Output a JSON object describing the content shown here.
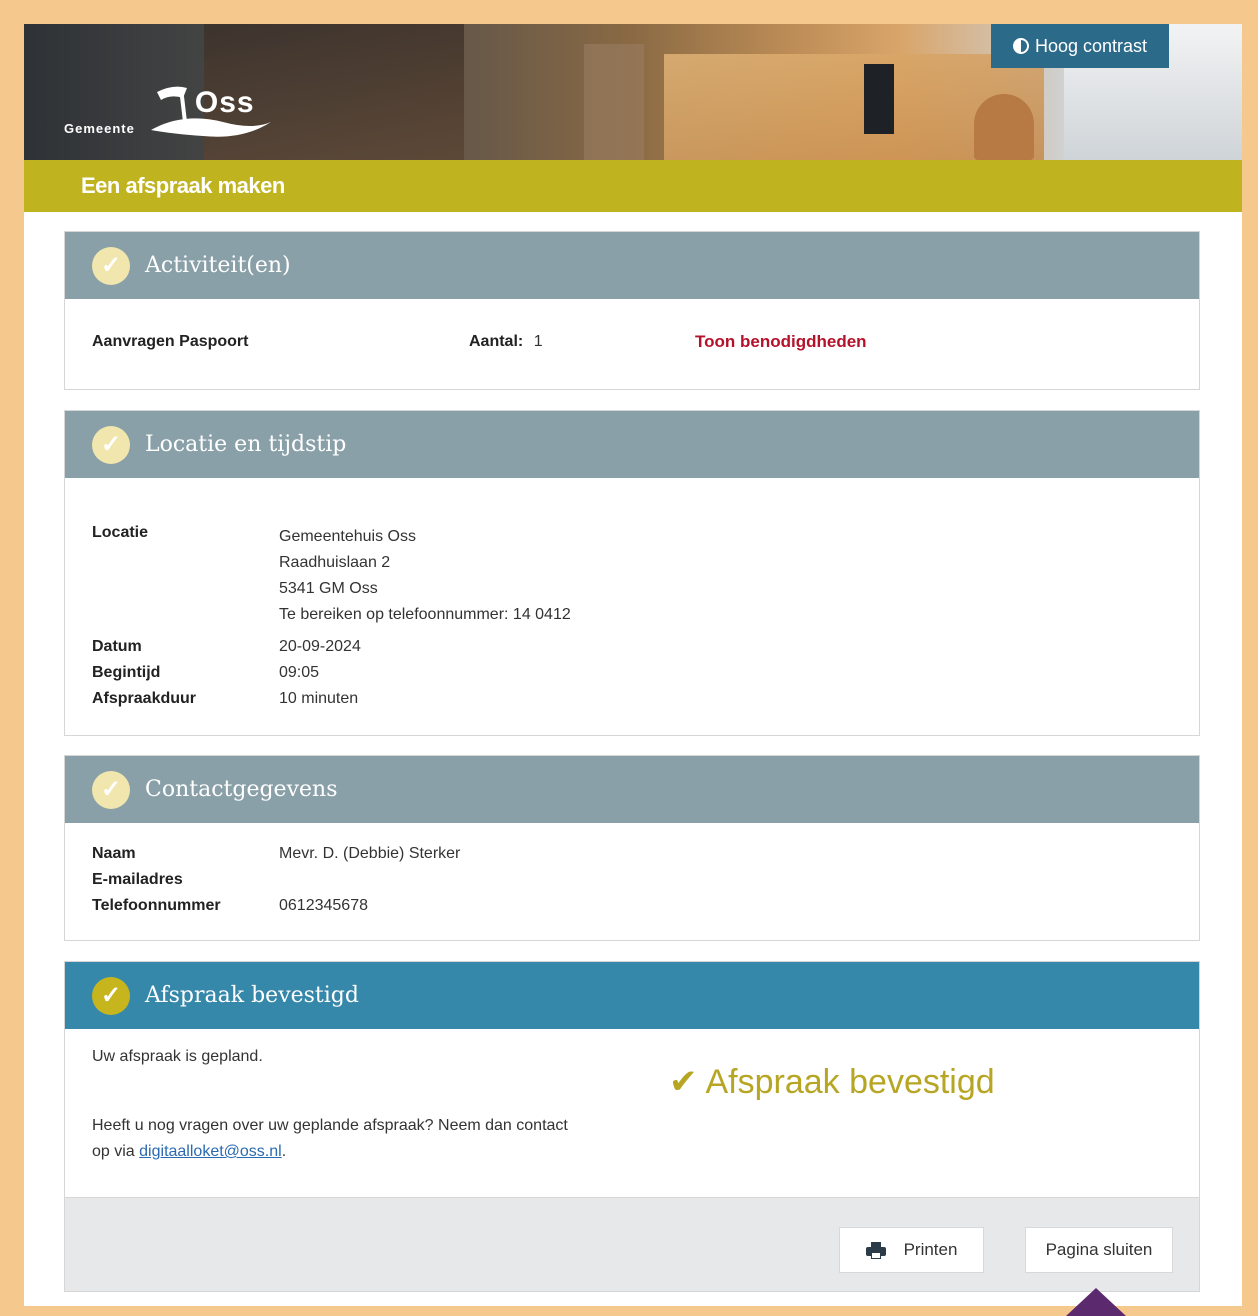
{
  "header": {
    "logo_gemeente": "Gemeente",
    "logo_oss": "Oss",
    "contrast_label": "Hoog contrast",
    "page_title": "Een afspraak maken"
  },
  "activities": {
    "title": "Activiteit(en)",
    "item_label": "Aanvragen Paspoort",
    "count_label": "Aantal:",
    "count_value": "1",
    "requirements_link": "Toon benodigdheden"
  },
  "location": {
    "title": "Locatie en tijdstip",
    "location_label": "Locatie",
    "location_lines": [
      "Gemeentehuis Oss",
      "Raadhuislaan 2",
      "5341 GM Oss",
      "Te bereiken op telefoonnummer: 14 0412"
    ],
    "date_label": "Datum",
    "date_value": "20-09-2024",
    "start_label": "Begintijd",
    "start_value": "09:05",
    "duration_label": "Afspraakduur",
    "duration_value": "10 minuten"
  },
  "contact": {
    "title": "Contactgegevens",
    "name_label": "Naam",
    "name_value": "Mevr. D. (Debbie) Sterker",
    "email_label": "E-mailadres",
    "email_value": "",
    "phone_label": "Telefoonnummer",
    "phone_value": "0612345678"
  },
  "confirmation": {
    "title": "Afspraak bevestigd",
    "planned_text": "Uw afspraak is gepland.",
    "question_text": "Heeft u nog vragen over uw geplande afspraak? Neem dan contact op via",
    "email_link": "digitaalloket@oss.nl",
    "period": ".",
    "big_label": "Afspraak bevestigd"
  },
  "footer": {
    "print_label": "Printen",
    "close_label": "Pagina sluiten"
  },
  "colors": {
    "frame": "#f5c98e",
    "title_bar": "#bfb31f",
    "section_header": "#8aa0a8",
    "confirm_header": "#3688aa",
    "link_red": "#b4122b",
    "confirm_gold": "#b7a624"
  }
}
